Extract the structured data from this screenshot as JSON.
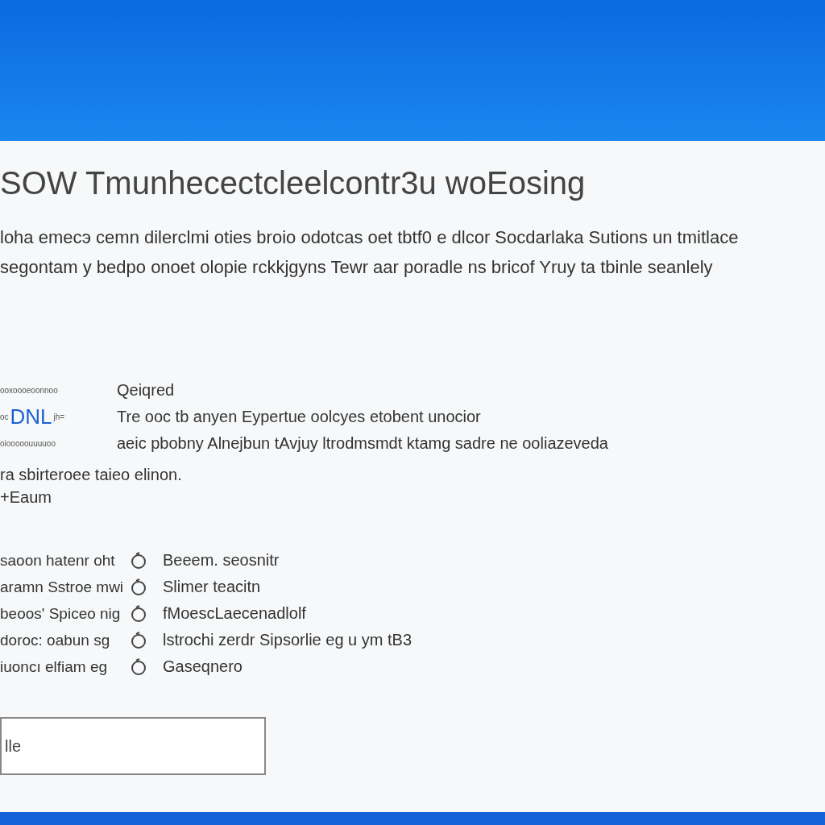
{
  "title": "SOW Tmunhecectcleelcontr3u woEosing",
  "description": [
    "loha emeсэ cemn dilerclmi oties broio odotcas oet tbtf0 e dlcor Socdarlaka Sutions un tmitlace",
    "segontam y bedpo onoet olopie rckkjgyns Tewr aar poradle ns bricof Yruy ta tbinle seanlely"
  ],
  "details": [
    {
      "label": "ooxoooeoonnoo",
      "value": "Qeiqred"
    },
    {
      "label": "oc",
      "link": "DNL",
      "suffix": "jh=",
      "value": "Tre ooc tb anyen Eypertue oolcyes etobent unocior"
    },
    {
      "label": "oiooooouuuuoo",
      "value": "aeic pbobny Alnejbun tAvjuy ltrodmsmdt ktamg sadre ne ooliazeveda"
    }
  ],
  "note": [
    "ra sbirteroee taieo elinon.",
    "+Eaum"
  ],
  "items": [
    {
      "label": "saoon hatenr oht",
      "value": "Beeem. seosnitr"
    },
    {
      "label": "aramn Sstroe mwi",
      "value": "Slimer teacitn"
    },
    {
      "label": "beoos' Spiceo nig",
      "value": "fMoescLaecenadlolf"
    },
    {
      "label": "doroc: oabun sg",
      "value": "lstrochi zerdr Sipsorlie eg u ym tB3"
    },
    {
      "label": "iuoncı elfiam eg",
      "value": "Gaseqnero"
    }
  ],
  "field": {
    "value": "lle"
  }
}
